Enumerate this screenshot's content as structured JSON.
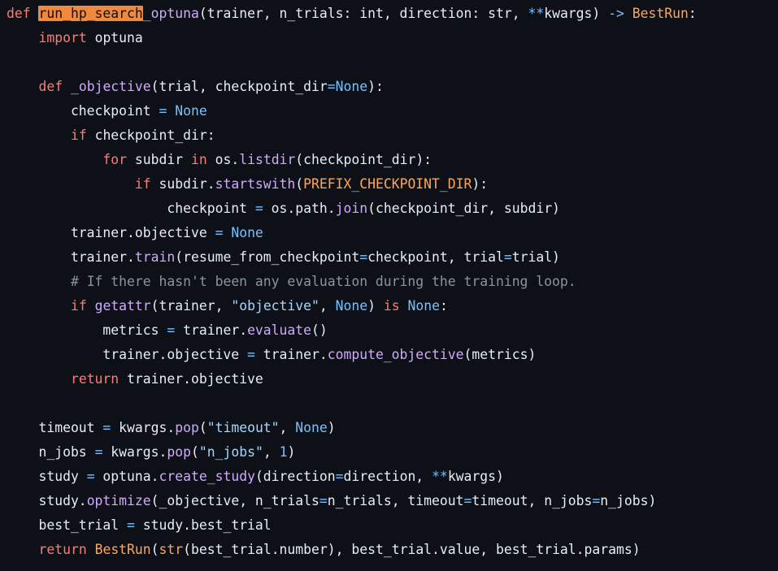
{
  "editor": {
    "lines": [
      {
        "tokens": [
          {
            "t": "def ",
            "c": "kw"
          },
          {
            "t": "run_hp_search",
            "c": "hl"
          },
          {
            "t": "_optuna",
            "c": "fn"
          },
          {
            "t": "(trainer, n_trials: int, direction: str, ",
            "c": "plain"
          },
          {
            "t": "**",
            "c": "op"
          },
          {
            "t": "kwargs) ",
            "c": "plain"
          },
          {
            "t": "->",
            "c": "op"
          },
          {
            "t": " ",
            "c": "plain"
          },
          {
            "t": "BestRun",
            "c": "cls"
          },
          {
            "t": ":",
            "c": "plain"
          }
        ]
      },
      {
        "tokens": [
          {
            "t": "    ",
            "c": "plain"
          },
          {
            "t": "import",
            "c": "kw"
          },
          {
            "t": " optuna",
            "c": "plain"
          }
        ]
      },
      {
        "tokens": []
      },
      {
        "tokens": [
          {
            "t": "    ",
            "c": "plain"
          },
          {
            "t": "def ",
            "c": "kw"
          },
          {
            "t": "_objective",
            "c": "fn"
          },
          {
            "t": "(trial, checkpoint_dir",
            "c": "plain"
          },
          {
            "t": "=",
            "c": "op"
          },
          {
            "t": "None",
            "c": "const"
          },
          {
            "t": "):",
            "c": "plain"
          }
        ]
      },
      {
        "tokens": [
          {
            "t": "        checkpoint ",
            "c": "plain"
          },
          {
            "t": "=",
            "c": "op"
          },
          {
            "t": " ",
            "c": "plain"
          },
          {
            "t": "None",
            "c": "const"
          }
        ]
      },
      {
        "tokens": [
          {
            "t": "        ",
            "c": "plain"
          },
          {
            "t": "if",
            "c": "kw"
          },
          {
            "t": " checkpoint_dir:",
            "c": "plain"
          }
        ]
      },
      {
        "tokens": [
          {
            "t": "            ",
            "c": "plain"
          },
          {
            "t": "for",
            "c": "kw"
          },
          {
            "t": " subdir ",
            "c": "plain"
          },
          {
            "t": "in",
            "c": "kw"
          },
          {
            "t": " os.",
            "c": "plain"
          },
          {
            "t": "listdir",
            "c": "fn"
          },
          {
            "t": "(checkpoint_dir):",
            "c": "plain"
          }
        ]
      },
      {
        "tokens": [
          {
            "t": "                ",
            "c": "plain"
          },
          {
            "t": "if",
            "c": "kw"
          },
          {
            "t": " subdir.",
            "c": "plain"
          },
          {
            "t": "startswith",
            "c": "fn"
          },
          {
            "t": "(",
            "c": "plain"
          },
          {
            "t": "PREFIX_CHECKPOINT_DIR",
            "c": "cls"
          },
          {
            "t": "):",
            "c": "plain"
          }
        ]
      },
      {
        "tokens": [
          {
            "t": "                    checkpoint ",
            "c": "plain"
          },
          {
            "t": "=",
            "c": "op"
          },
          {
            "t": " os.path.",
            "c": "plain"
          },
          {
            "t": "join",
            "c": "fn"
          },
          {
            "t": "(checkpoint_dir, subdir)",
            "c": "plain"
          }
        ]
      },
      {
        "tokens": [
          {
            "t": "        trainer.objective ",
            "c": "plain"
          },
          {
            "t": "=",
            "c": "op"
          },
          {
            "t": " ",
            "c": "plain"
          },
          {
            "t": "None",
            "c": "const"
          }
        ]
      },
      {
        "tokens": [
          {
            "t": "        trainer.",
            "c": "plain"
          },
          {
            "t": "train",
            "c": "fn"
          },
          {
            "t": "(resume_from_checkpoint",
            "c": "plain"
          },
          {
            "t": "=",
            "c": "op"
          },
          {
            "t": "checkpoint, trial",
            "c": "plain"
          },
          {
            "t": "=",
            "c": "op"
          },
          {
            "t": "trial)",
            "c": "plain"
          }
        ]
      },
      {
        "tokens": [
          {
            "t": "        ",
            "c": "plain"
          },
          {
            "t": "# If there hasn't been any evaluation during the training loop.",
            "c": "comment"
          }
        ]
      },
      {
        "tokens": [
          {
            "t": "        ",
            "c": "plain"
          },
          {
            "t": "if",
            "c": "kw"
          },
          {
            "t": " ",
            "c": "plain"
          },
          {
            "t": "getattr",
            "c": "fn"
          },
          {
            "t": "(trainer, ",
            "c": "plain"
          },
          {
            "t": "\"objective\"",
            "c": "str"
          },
          {
            "t": ", ",
            "c": "plain"
          },
          {
            "t": "None",
            "c": "const"
          },
          {
            "t": ") ",
            "c": "plain"
          },
          {
            "t": "is",
            "c": "kw"
          },
          {
            "t": " ",
            "c": "plain"
          },
          {
            "t": "None",
            "c": "const"
          },
          {
            "t": ":",
            "c": "plain"
          }
        ]
      },
      {
        "tokens": [
          {
            "t": "            metrics ",
            "c": "plain"
          },
          {
            "t": "=",
            "c": "op"
          },
          {
            "t": " trainer.",
            "c": "plain"
          },
          {
            "t": "evaluate",
            "c": "fn"
          },
          {
            "t": "()",
            "c": "plain"
          }
        ]
      },
      {
        "tokens": [
          {
            "t": "            trainer.objective ",
            "c": "plain"
          },
          {
            "t": "=",
            "c": "op"
          },
          {
            "t": " trainer.",
            "c": "plain"
          },
          {
            "t": "compute_objective",
            "c": "fn"
          },
          {
            "t": "(metrics)",
            "c": "plain"
          }
        ]
      },
      {
        "tokens": [
          {
            "t": "        ",
            "c": "plain"
          },
          {
            "t": "return",
            "c": "kw"
          },
          {
            "t": " trainer.objective",
            "c": "plain"
          }
        ]
      },
      {
        "tokens": []
      },
      {
        "tokens": [
          {
            "t": "    timeout ",
            "c": "plain"
          },
          {
            "t": "=",
            "c": "op"
          },
          {
            "t": " kwargs.",
            "c": "plain"
          },
          {
            "t": "pop",
            "c": "fn"
          },
          {
            "t": "(",
            "c": "plain"
          },
          {
            "t": "\"timeout\"",
            "c": "str"
          },
          {
            "t": ", ",
            "c": "plain"
          },
          {
            "t": "None",
            "c": "const"
          },
          {
            "t": ")",
            "c": "plain"
          }
        ]
      },
      {
        "tokens": [
          {
            "t": "    n_jobs ",
            "c": "plain"
          },
          {
            "t": "=",
            "c": "op"
          },
          {
            "t": " kwargs.",
            "c": "plain"
          },
          {
            "t": "pop",
            "c": "fn"
          },
          {
            "t": "(",
            "c": "plain"
          },
          {
            "t": "\"n_jobs\"",
            "c": "str"
          },
          {
            "t": ", ",
            "c": "plain"
          },
          {
            "t": "1",
            "c": "num"
          },
          {
            "t": ")",
            "c": "plain"
          }
        ]
      },
      {
        "tokens": [
          {
            "t": "    study ",
            "c": "plain"
          },
          {
            "t": "=",
            "c": "op"
          },
          {
            "t": " optuna.",
            "c": "plain"
          },
          {
            "t": "create_study",
            "c": "fn"
          },
          {
            "t": "(direction",
            "c": "plain"
          },
          {
            "t": "=",
            "c": "op"
          },
          {
            "t": "direction, ",
            "c": "plain"
          },
          {
            "t": "**",
            "c": "op"
          },
          {
            "t": "kwargs)",
            "c": "plain"
          }
        ]
      },
      {
        "tokens": [
          {
            "t": "    study.",
            "c": "plain"
          },
          {
            "t": "optimize",
            "c": "fn"
          },
          {
            "t": "(_objective, n_trials",
            "c": "plain"
          },
          {
            "t": "=",
            "c": "op"
          },
          {
            "t": "n_trials, timeout",
            "c": "plain"
          },
          {
            "t": "=",
            "c": "op"
          },
          {
            "t": "timeout, n_jobs",
            "c": "plain"
          },
          {
            "t": "=",
            "c": "op"
          },
          {
            "t": "n_jobs)",
            "c": "plain"
          }
        ]
      },
      {
        "tokens": [
          {
            "t": "    best_trial ",
            "c": "plain"
          },
          {
            "t": "=",
            "c": "op"
          },
          {
            "t": " study.best_trial",
            "c": "plain"
          }
        ]
      },
      {
        "tokens": [
          {
            "t": "    ",
            "c": "plain"
          },
          {
            "t": "return",
            "c": "kw"
          },
          {
            "t": " ",
            "c": "plain"
          },
          {
            "t": "BestRun",
            "c": "cls"
          },
          {
            "t": "(",
            "c": "plain"
          },
          {
            "t": "str",
            "c": "builtin"
          },
          {
            "t": "(best_trial.number), best_trial.value, best_trial.params)",
            "c": "plain"
          }
        ]
      }
    ]
  },
  "theme": {
    "background": "#0d1117",
    "text": "#e6edf3",
    "keyword": "#ff7b72",
    "function": "#d2a8ff",
    "class": "#ffa657",
    "constant": "#79c0ff",
    "string": "#a5d6ff",
    "comment": "#8b949e",
    "selection_highlight": "#f0883e"
  }
}
